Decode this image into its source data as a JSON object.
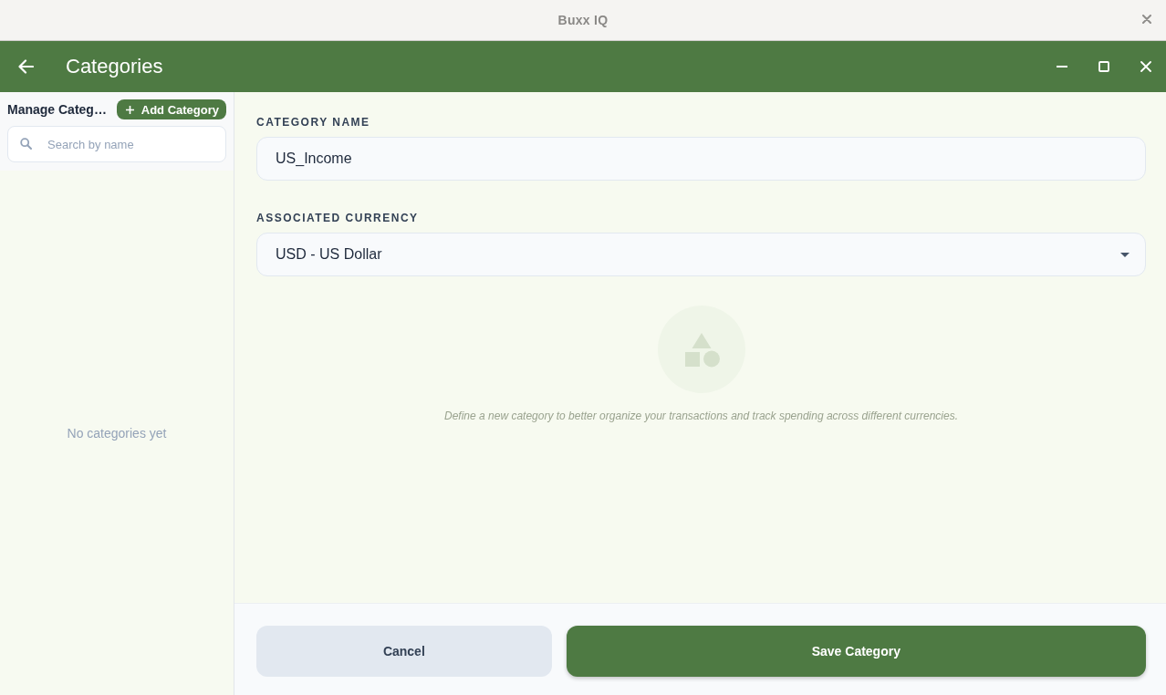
{
  "window": {
    "title": "Buxx IQ"
  },
  "app_bar": {
    "title": "Categories"
  },
  "sidebar": {
    "heading": "Manage Categ…",
    "add_button": {
      "label": "Add Category"
    },
    "search": {
      "placeholder": "Search by name"
    },
    "empty_message": "No categories yet"
  },
  "form": {
    "fields": [
      {
        "kind": "text",
        "label": "CATEGORY NAME",
        "value": "US_Income"
      },
      {
        "kind": "select",
        "label": "ASSOCIATED CURRENCY",
        "value": "USD - US Dollar"
      }
    ],
    "hint": "Define a new category to better organize your transactions and track spending across different currencies."
  },
  "footer": {
    "buttons": [
      {
        "kind": "secondary",
        "label": "Cancel"
      },
      {
        "kind": "primary",
        "label": "Save Category"
      }
    ]
  }
}
